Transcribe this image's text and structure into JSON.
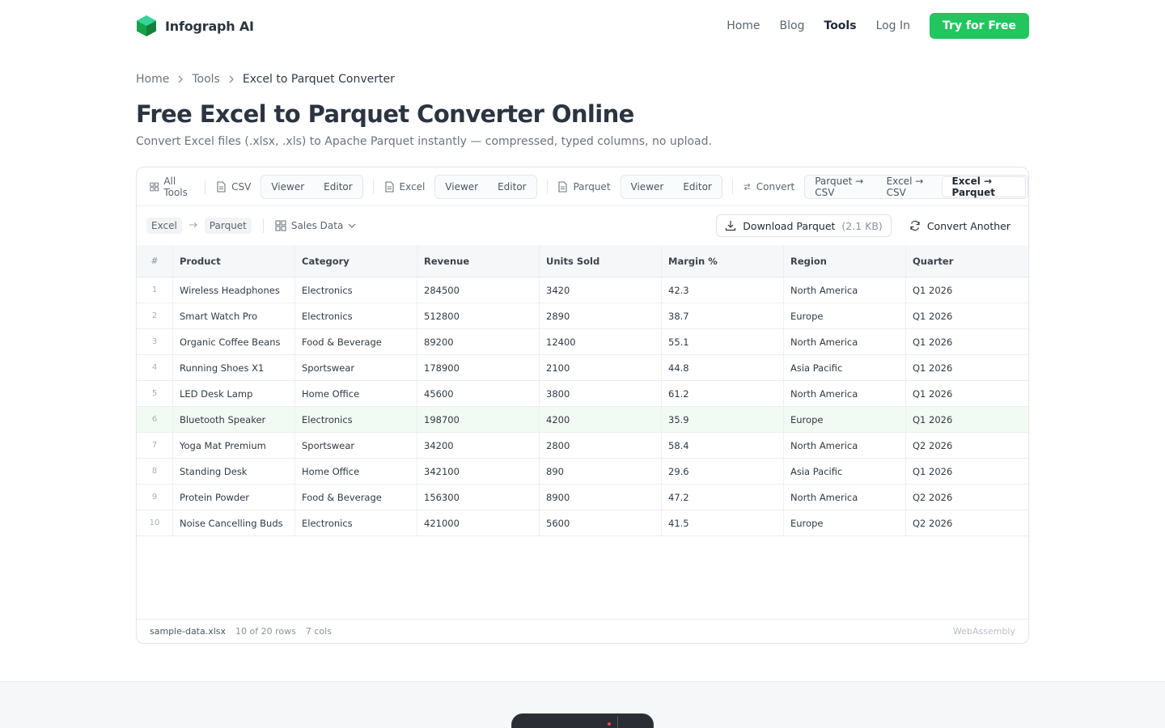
{
  "nav": {
    "brand": "Infograph AI",
    "links": [
      "Home",
      "Blog",
      "Tools",
      "Log In"
    ],
    "active": "Tools",
    "cta": "Try for Free",
    "accent": "#22c55e"
  },
  "breadcrumb": [
    "Home",
    "Tools",
    "Excel to Parquet Converter"
  ],
  "page": {
    "title": "Free Excel to Parquet Converter Online",
    "subtitle": "Convert Excel files (.xlsx, .xls) to Apache Parquet instantly — compressed, typed columns, no upload."
  },
  "toolbar": {
    "all_tools": "All Tools",
    "csv": "CSV",
    "excel": "Excel",
    "parquet": "Parquet",
    "viewer": "Viewer",
    "editor": "Editor",
    "convert": "Convert",
    "conversions": [
      "Parquet → CSV",
      "Excel → CSV",
      "Excel → Parquet"
    ],
    "active_conversion": "Excel → Parquet"
  },
  "subbar": {
    "from": "Excel",
    "to": "Parquet",
    "sheet": "Sales Data",
    "download_label": "Download Parquet",
    "download_size": "(2.1 KB)",
    "convert_another": "Convert Another"
  },
  "table": {
    "headers": [
      "#",
      "Product",
      "Category",
      "Revenue",
      "Units Sold",
      "Margin %",
      "Region",
      "Quarter"
    ],
    "rows": [
      [
        "1",
        "Wireless Headphones",
        "Electronics",
        "284500",
        "3420",
        "42.3",
        "North America",
        "Q1 2026"
      ],
      [
        "2",
        "Smart Watch Pro",
        "Electronics",
        "512800",
        "2890",
        "38.7",
        "Europe",
        "Q1 2026"
      ],
      [
        "3",
        "Organic Coffee Beans",
        "Food & Beverage",
        "89200",
        "12400",
        "55.1",
        "North America",
        "Q1 2026"
      ],
      [
        "4",
        "Running Shoes X1",
        "Sportswear",
        "178900",
        "2100",
        "44.8",
        "Asia Pacific",
        "Q1 2026"
      ],
      [
        "5",
        "LED Desk Lamp",
        "Home Office",
        "45600",
        "3800",
        "61.2",
        "North America",
        "Q1 2026"
      ],
      [
        "6",
        "Bluetooth Speaker",
        "Electronics",
        "198700",
        "4200",
        "35.9",
        "Europe",
        "Q1 2026"
      ],
      [
        "7",
        "Yoga Mat Premium",
        "Sportswear",
        "34200",
        "2800",
        "58.4",
        "North America",
        "Q2 2026"
      ],
      [
        "8",
        "Standing Desk",
        "Home Office",
        "342100",
        "890",
        "29.6",
        "Asia Pacific",
        "Q1 2026"
      ],
      [
        "9",
        "Protein Powder",
        "Food & Beverage",
        "156300",
        "8900",
        "47.2",
        "North America",
        "Q2 2026"
      ],
      [
        "10",
        "Noise Cancelling Buds",
        "Electronics",
        "421000",
        "5600",
        "41.5",
        "Europe",
        "Q2 2026"
      ]
    ],
    "highlighted_row": 6
  },
  "footer": {
    "filename": "sample-data.xlsx",
    "rows": "10 of 20 rows",
    "cols": "7 cols",
    "engine": "WebAssembly"
  }
}
